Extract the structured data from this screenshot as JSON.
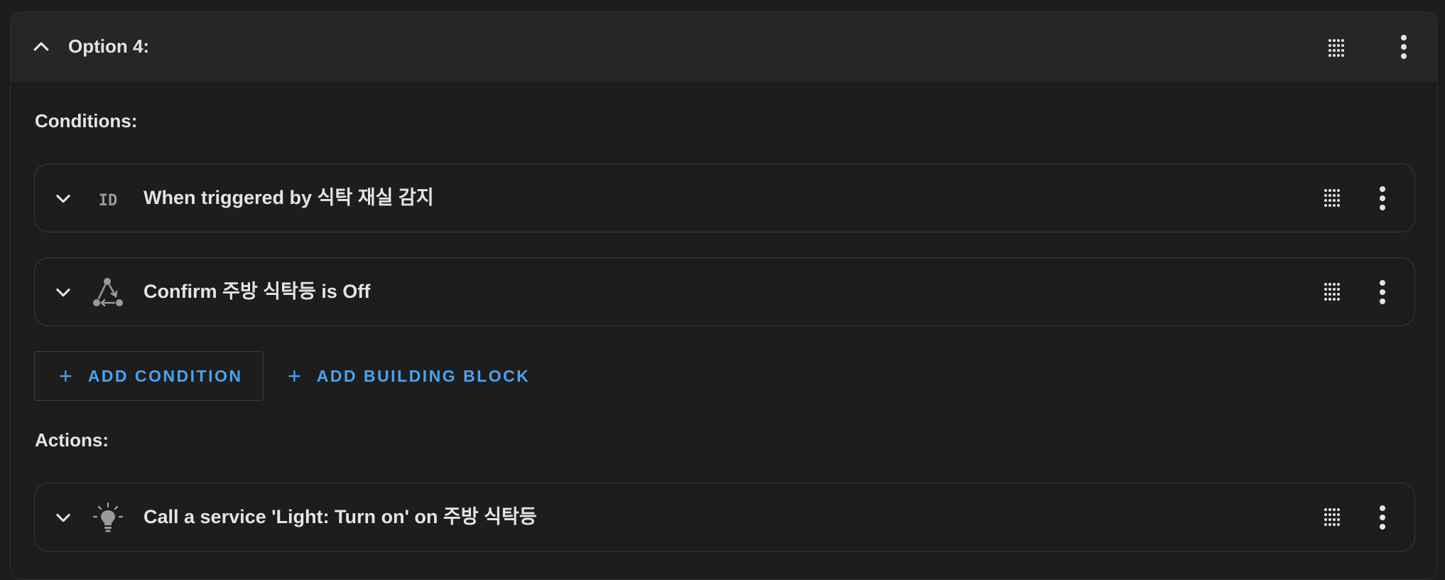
{
  "option": {
    "title": "Option 4:"
  },
  "conditions": {
    "label": "Conditions:",
    "items": [
      {
        "text": "When triggered by 식탁 재실 감지",
        "icon": "id-icon"
      },
      {
        "text": "Confirm 주방 식탁등 is Off",
        "icon": "state-icon"
      }
    ],
    "add_condition_label": "ADD CONDITION",
    "add_building_block_label": "ADD BUILDING BLOCK"
  },
  "actions": {
    "label": "Actions:",
    "items": [
      {
        "text": "Call a service 'Light: Turn on' on 주방 식탁등",
        "icon": "lightbulb-icon"
      }
    ]
  },
  "colors": {
    "background": "#1c1c1c",
    "header": "#262626",
    "accent": "#4aa3f0",
    "text": "#e4e4e4",
    "icon": "#9a9a9a"
  }
}
